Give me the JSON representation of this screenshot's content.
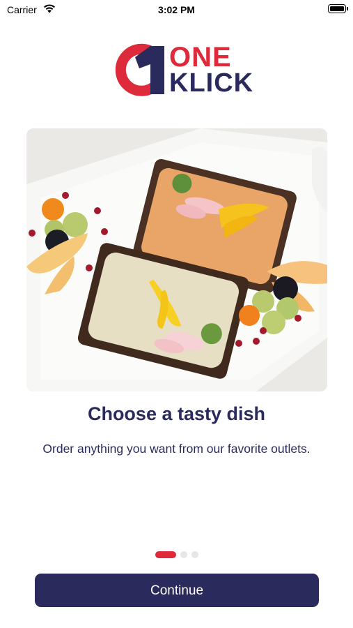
{
  "status_bar": {
    "carrier": "Carrier",
    "time": "3:02 PM"
  },
  "logo": {
    "line1": "ONE",
    "line2": "KLICK",
    "mark_digit": "1"
  },
  "hero_image": {
    "alt": "Two rye toasts with hummus, radish and pepper slices on a white plate"
  },
  "onboarding": {
    "title": "Choose a tasty dish",
    "subtitle": "Order anything you want from our favorite outlets.",
    "page_count": 3,
    "active_page": 1
  },
  "continue_button": {
    "label": "Continue"
  },
  "colors": {
    "brand_red": "#dd2b3b",
    "brand_navy": "#2b2a5c",
    "dot_inactive": "#e6e6e9"
  }
}
